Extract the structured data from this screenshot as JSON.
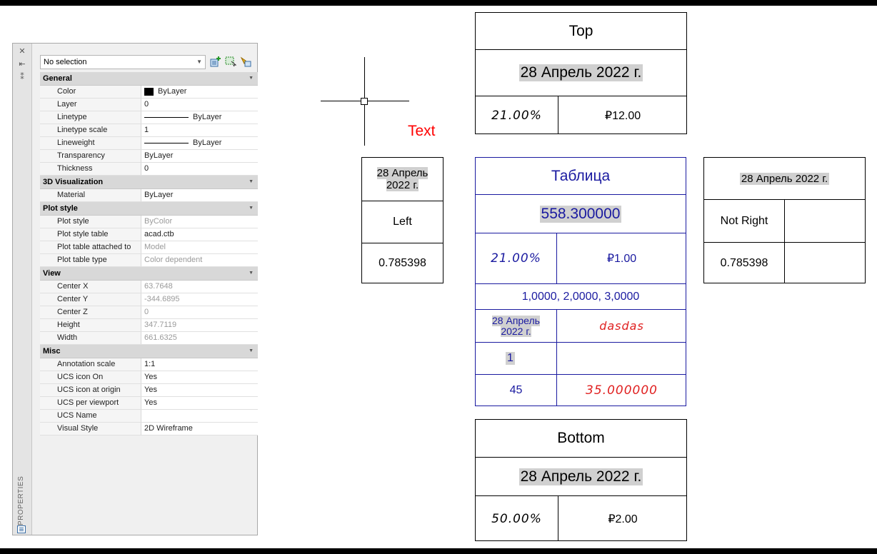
{
  "palette": {
    "strip": {
      "close": "✕",
      "autohide": "⇤",
      "settings": "⁑",
      "title": "PROPERTIES"
    },
    "selection": "No selection",
    "toolbar_icons": [
      "toggle-pickadd-icon",
      "select-objects-icon",
      "quick-select-icon"
    ],
    "categories": [
      {
        "name": "General",
        "rows": [
          {
            "k": "Color",
            "v": "ByLayer",
            "type": "color"
          },
          {
            "k": "Layer",
            "v": "0"
          },
          {
            "k": "Linetype",
            "v": "ByLayer",
            "type": "line"
          },
          {
            "k": "Linetype scale",
            "v": "1"
          },
          {
            "k": "Lineweight",
            "v": "ByLayer",
            "type": "line"
          },
          {
            "k": "Transparency",
            "v": "ByLayer"
          },
          {
            "k": "Thickness",
            "v": "0"
          }
        ]
      },
      {
        "name": "3D Visualization",
        "rows": [
          {
            "k": "Material",
            "v": "ByLayer"
          }
        ]
      },
      {
        "name": "Plot style",
        "rows": [
          {
            "k": "Plot style",
            "v": "ByColor",
            "dim": true
          },
          {
            "k": "Plot style table",
            "v": "acad.ctb"
          },
          {
            "k": "Plot table attached to",
            "v": "Model",
            "dim": true
          },
          {
            "k": "Plot table type",
            "v": "Color dependent",
            "dim": true
          }
        ]
      },
      {
        "name": "View",
        "rows": [
          {
            "k": "Center X",
            "v": "63.7648",
            "dim": true
          },
          {
            "k": "Center Y",
            "v": "-344.6895",
            "dim": true
          },
          {
            "k": "Center Z",
            "v": "0",
            "dim": true
          },
          {
            "k": "Height",
            "v": "347.7119",
            "dim": true
          },
          {
            "k": "Width",
            "v": "661.6325",
            "dim": true
          }
        ]
      },
      {
        "name": "Misc",
        "rows": [
          {
            "k": "Annotation scale",
            "v": "1:1"
          },
          {
            "k": "UCS icon On",
            "v": "Yes"
          },
          {
            "k": "UCS icon at origin",
            "v": "Yes"
          },
          {
            "k": "UCS per viewport",
            "v": "Yes"
          },
          {
            "k": "UCS Name",
            "v": ""
          },
          {
            "k": "Visual Style",
            "v": "2D Wireframe"
          }
        ]
      }
    ]
  },
  "drawing": {
    "text_label": "Text",
    "text_color": "#ff0000",
    "top_table": {
      "title": "Top",
      "date": "28 Апрель 2022 г.",
      "percent": "21.00%",
      "currency": "₽12.00"
    },
    "left_table": {
      "date_line1": "28 Апрель",
      "date_line2": "2022 г.",
      "label": "Left",
      "value": "0.785398"
    },
    "center_table": {
      "title": "Таблица",
      "number": "558.300000",
      "percent": "21.00%",
      "currency": "₽1.00",
      "list": "1,0000, 2,0000, 3,0000",
      "date_line1": "28 Апрель",
      "date_line2": "2022 г.",
      "script_text": "dasdas",
      "one": "1",
      "count": "45",
      "decimal": "35.000000",
      "blue": "#1a1aa0",
      "red": "#e02020"
    },
    "right_table": {
      "date": "28 Апрель 2022 г.",
      "label": "Not Right",
      "value": "0.785398"
    },
    "bottom_table": {
      "title": "Bottom",
      "date": "28 Апрель 2022 г.",
      "percent": "50.00%",
      "currency": "₽2.00"
    }
  }
}
